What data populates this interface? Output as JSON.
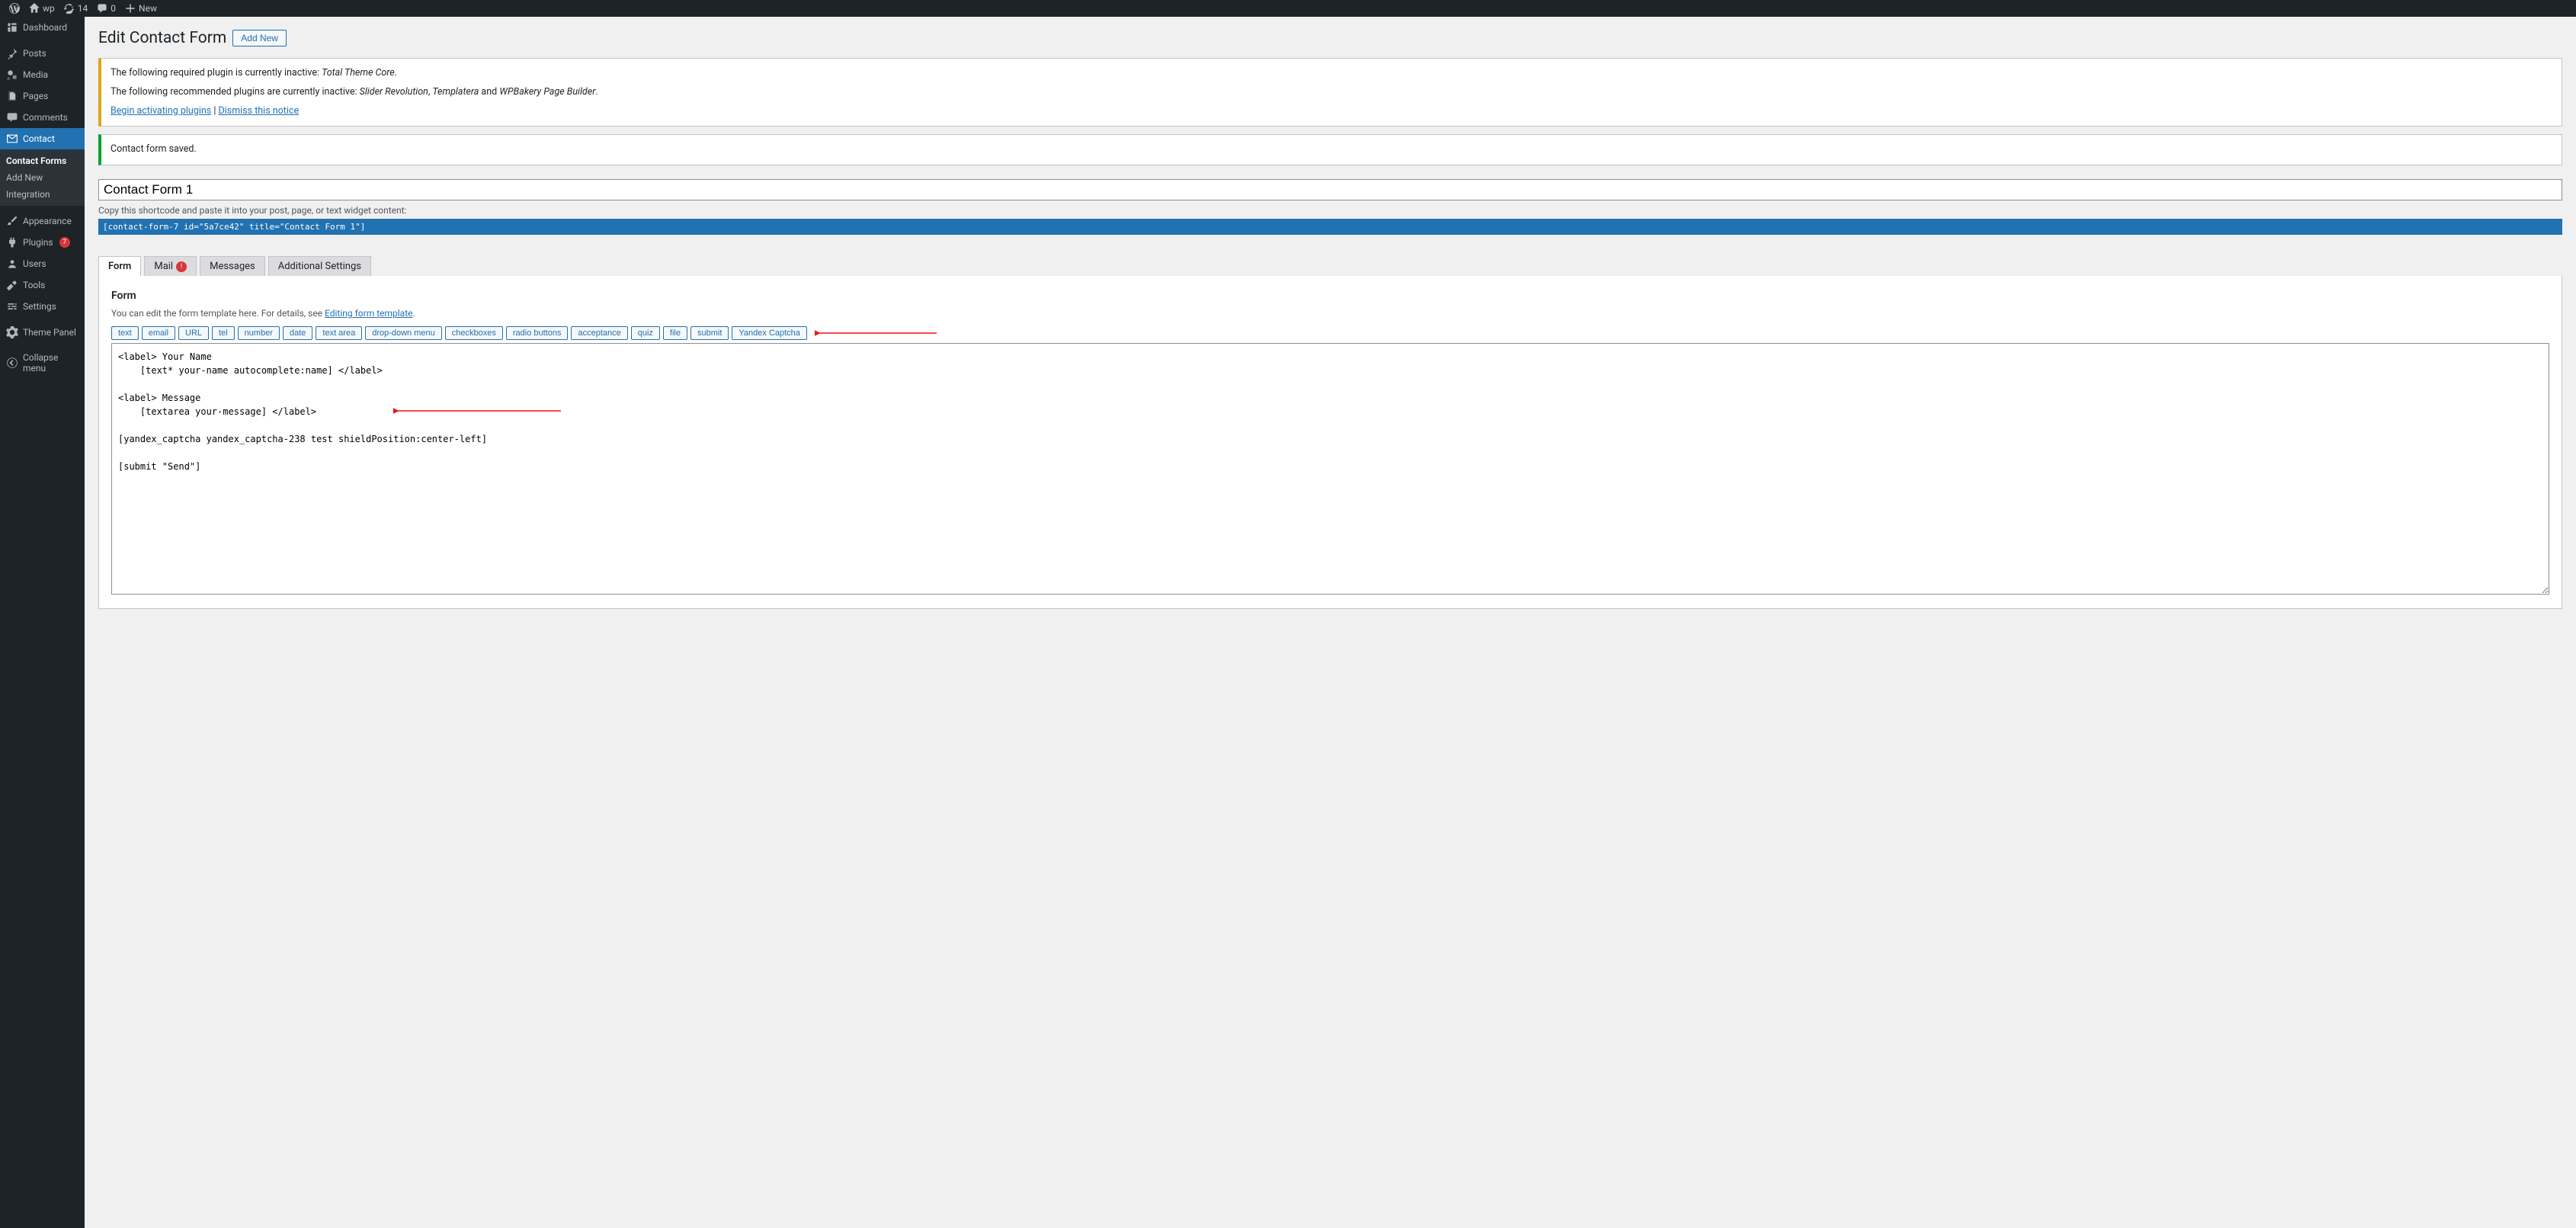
{
  "adminbar": {
    "site": "wp",
    "updates": "14",
    "comments": "0",
    "new": "New"
  },
  "sidebar": {
    "dashboard": "Dashboard",
    "posts": "Posts",
    "media": "Media",
    "pages": "Pages",
    "comments": "Comments",
    "contact": "Contact",
    "contact_sub": {
      "forms": "Contact Forms",
      "add": "Add New",
      "integration": "Integration"
    },
    "appearance": "Appearance",
    "plugins": "Plugins",
    "plugins_count": "7",
    "users": "Users",
    "tools": "Tools",
    "settings": "Settings",
    "theme_panel": "Theme Panel",
    "collapse": "Collapse menu"
  },
  "page": {
    "title": "Edit Contact Form",
    "add_new": "Add New",
    "notice1_a": "The following required plugin is currently inactive: ",
    "notice1_b": "Total Theme Core",
    "notice1_end": ".",
    "notice2_a": "The following recommended plugins are currently inactive: ",
    "notice2_b": "Slider Revolution",
    "notice2_sep1": ", ",
    "notice2_c": "Templatera",
    "notice2_and": " and ",
    "notice2_d": "WPBakery Page Builder",
    "notice2_end": ".",
    "activate_link": "Begin activating plugins",
    "pipe": " | ",
    "dismiss_link": "Dismiss this notice",
    "saved": "Contact form saved.",
    "form_title": "Contact Form 1",
    "shortcode_help": "Copy this shortcode and paste it into your post, page, or text widget content:",
    "shortcode": "[contact-form-7 id=\"5a7ce42\" title=\"Contact Form 1\"]",
    "tabs": {
      "form": "Form",
      "mail": "Mail",
      "messages": "Messages",
      "additional": "Additional Settings"
    },
    "form_heading": "Form",
    "form_desc_a": "You can edit the form template here. For details, see ",
    "form_desc_link": "Editing form template",
    "form_desc_end": ".",
    "tags": {
      "text": "text",
      "email": "email",
      "url": "URL",
      "tel": "tel",
      "number": "number",
      "date": "date",
      "textarea": "text area",
      "dropdown": "drop-down menu",
      "checkboxes": "checkboxes",
      "radio": "radio buttons",
      "acceptance": "acceptance",
      "quiz": "quiz",
      "file": "file",
      "submit": "submit",
      "yandex": "Yandex Captcha"
    },
    "code": "<label> Your Name\n    [text* your-name autocomplete:name] </label>\n\n<label> Message\n    [textarea your-message] </label>\n\n[yandex_captcha yandex_captcha-238 test shieldPosition:center-left]\n\n[submit \"Send\"]"
  }
}
